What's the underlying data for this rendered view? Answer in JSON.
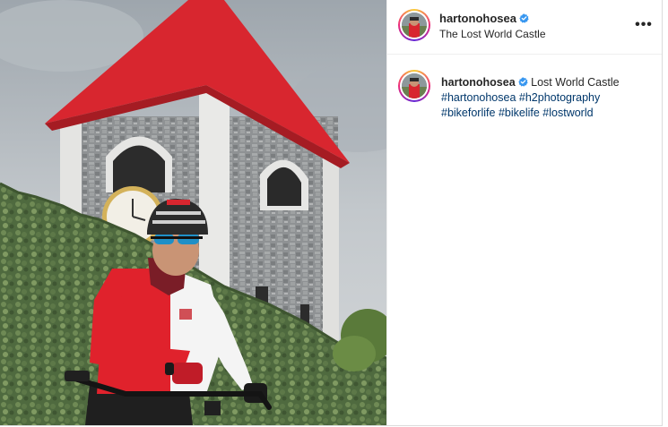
{
  "post": {
    "username": "hartonohosea",
    "location": "The Lost World Castle",
    "more_label": "•••",
    "caption": {
      "username": "hartonohosea",
      "text": "Lost World Castle",
      "hashtags": [
        "#hartonohosea",
        "#h2photography",
        "#bikeforlife",
        "#bikelife",
        "#lostworld"
      ]
    }
  },
  "colors": {
    "roof": "#d8262f",
    "verified": "#3897f0",
    "hashtag": "#00376b",
    "jersey": "#e0222c"
  },
  "icons": {
    "verified": "verified-badge-icon",
    "more": "more-options-icon"
  }
}
